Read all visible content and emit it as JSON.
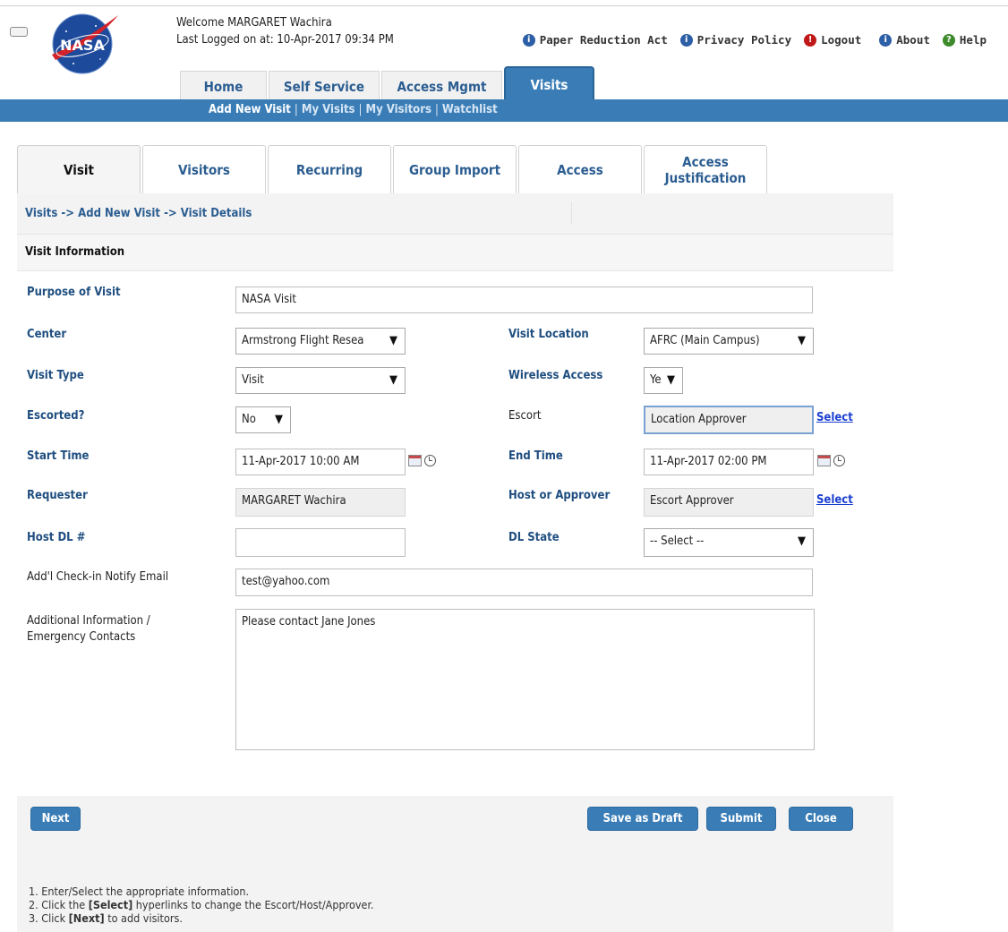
{
  "header": {
    "welcome": "Welcome MARGARET Wachira",
    "last_logged": "Last Logged on at: 10-Apr-2017 09:34 PM",
    "logo_text": "NASA",
    "links": [
      {
        "label": "Paper Reduction Act",
        "icon": "info-icon"
      },
      {
        "label": "Privacy Policy",
        "icon": "info-icon"
      },
      {
        "label": "Logout",
        "icon": "alert-icon"
      },
      {
        "label": "About",
        "icon": "info-icon"
      },
      {
        "label": "Help",
        "icon": "help-icon"
      }
    ]
  },
  "main_tabs": [
    {
      "label": "Home",
      "active": false
    },
    {
      "label": "Self Service",
      "active": false
    },
    {
      "label": "Access Mgmt",
      "active": false
    },
    {
      "label": "Visits",
      "active": true
    }
  ],
  "subnav": {
    "items": [
      "Add New Visit",
      "My Visits",
      "My Visitors",
      "Watchlist"
    ],
    "separator": "|"
  },
  "visit_tabs": [
    {
      "label": "Visit",
      "active": true
    },
    {
      "label": "Visitors",
      "active": false
    },
    {
      "label": "Recurring",
      "active": false
    },
    {
      "label": "Group Import",
      "active": false
    },
    {
      "label": "Access",
      "active": false
    },
    {
      "label": "Access Justification",
      "active": false
    }
  ],
  "breadcrumb": "Visits -> Add New Visit -> Visit Details",
  "section_title": "Visit Information",
  "form": {
    "purpose": {
      "label": "Purpose of Visit",
      "value": "NASA Visit"
    },
    "center": {
      "label": "Center",
      "value": "Armstrong Flight Resea"
    },
    "visit_location": {
      "label": "Visit Location",
      "value": "AFRC (Main Campus)"
    },
    "visit_type": {
      "label": "Visit Type",
      "value": "Visit"
    },
    "wireless": {
      "label": "Wireless Access",
      "value": "Ye"
    },
    "escorted": {
      "label": "Escorted?",
      "value": "No"
    },
    "escort": {
      "label": "Escort",
      "value": "Location Approver",
      "link": "Select"
    },
    "start_time": {
      "label": "Start Time",
      "value": "11-Apr-2017 10:00 AM"
    },
    "end_time": {
      "label": "End Time",
      "value": "11-Apr-2017 02:00 PM"
    },
    "requester": {
      "label": "Requester",
      "value": "MARGARET Wachira"
    },
    "host": {
      "label": "Host or Approver",
      "value": "Escort Approver",
      "link": "Select"
    },
    "host_dl": {
      "label": "Host DL #",
      "value": ""
    },
    "dl_state": {
      "label": "DL State",
      "value": "-- Select --"
    },
    "notify_email": {
      "label": "Add'l Check-in Notify Email",
      "value": "test@yahoo.com"
    },
    "additional_info": {
      "label_line1": "Additional Information /",
      "label_line2": "Emergency Contacts",
      "value": "Please contact Jane Jones"
    }
  },
  "buttons": {
    "next": "Next",
    "save_draft": "Save as Draft",
    "submit": "Submit",
    "close": "Close"
  },
  "instructions": {
    "line1": "1. Enter/Select the appropriate information.",
    "line2_pre": "2. Click the ",
    "line2_bold": "[Select]",
    "line2_post": " hyperlinks to change the Escort/Host/Approver.",
    "line3_pre": "3. Click ",
    "line3_bold": "[Next]",
    "line3_post": " to add visitors."
  },
  "colors": {
    "brand_blue": "#3a7db6",
    "link_blue": "#2b5d91"
  }
}
